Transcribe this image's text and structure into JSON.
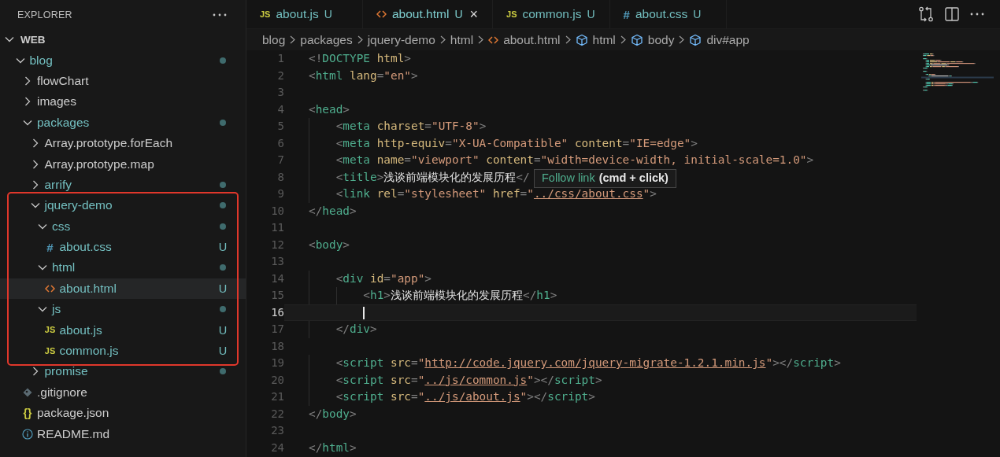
{
  "explorer": {
    "title": "EXPLORER",
    "root": {
      "label": "WEB",
      "expanded": true
    },
    "tree": [
      {
        "label": "blog",
        "kind": "folder",
        "expanded": true,
        "changed": true,
        "selected": false,
        "children": [
          {
            "label": "flowChart",
            "kind": "folder",
            "expanded": false,
            "changed": false,
            "selected": false
          },
          {
            "label": "images",
            "kind": "folder",
            "expanded": false,
            "changed": false,
            "selected": false
          },
          {
            "label": "packages",
            "kind": "folder",
            "expanded": true,
            "changed": true,
            "selected": false,
            "children": [
              {
                "label": "Array.prototype.forEach",
                "kind": "folder",
                "expanded": false,
                "changed": false,
                "selected": false
              },
              {
                "label": "Array.prototype.map",
                "kind": "folder",
                "expanded": false,
                "changed": false,
                "selected": false
              },
              {
                "label": "arrify",
                "kind": "folder",
                "expanded": false,
                "changed": true,
                "selected": false
              },
              {
                "label": "jquery-demo",
                "kind": "folder",
                "expanded": true,
                "changed": true,
                "highlight": true,
                "selected": false,
                "children": [
                  {
                    "label": "css",
                    "kind": "folder",
                    "expanded": true,
                    "changed": true,
                    "selected": false,
                    "children": [
                      {
                        "label": "about.css",
                        "kind": "css",
                        "glyph": "#",
                        "changed": true,
                        "badge": "U",
                        "selected": false
                      }
                    ]
                  },
                  {
                    "label": "html",
                    "kind": "folder",
                    "expanded": true,
                    "changed": true,
                    "selected": false,
                    "children": [
                      {
                        "label": "about.html",
                        "kind": "html",
                        "changed": true,
                        "badge": "U",
                        "selected": true
                      }
                    ]
                  },
                  {
                    "label": "js",
                    "kind": "folder",
                    "expanded": true,
                    "changed": true,
                    "selected": false,
                    "children": [
                      {
                        "label": "about.js",
                        "kind": "js",
                        "glyph": "JS",
                        "changed": true,
                        "badge": "U",
                        "selected": false
                      },
                      {
                        "label": "common.js",
                        "kind": "js",
                        "glyph": "JS",
                        "changed": true,
                        "badge": "U",
                        "selected": false
                      }
                    ]
                  }
                ]
              },
              {
                "label": "promise",
                "kind": "folder",
                "expanded": false,
                "changed": true,
                "selected": false
              }
            ]
          },
          {
            "label": ".gitignore",
            "kind": "git",
            "changed": false,
            "selected": false
          },
          {
            "label": "package.json",
            "kind": "json",
            "glyph": "{}",
            "changed": false,
            "selected": false
          },
          {
            "label": "README.md",
            "kind": "info",
            "changed": false,
            "selected": false
          }
        ]
      }
    ]
  },
  "tabs": [
    {
      "label": "about.js",
      "kind": "js",
      "glyph": "JS",
      "badge": "U",
      "selected": false
    },
    {
      "label": "about.html",
      "kind": "html",
      "badge": "U",
      "close": "×",
      "selected": true
    },
    {
      "label": "common.js",
      "kind": "js",
      "glyph": "JS",
      "badge": "U",
      "selected": false
    },
    {
      "label": "about.css",
      "kind": "css",
      "glyph": "#",
      "badge": "U",
      "selected": false
    }
  ],
  "breadcrumbs": [
    {
      "label": "blog",
      "kind": "folder"
    },
    {
      "label": "packages",
      "kind": "folder"
    },
    {
      "label": "jquery-demo",
      "kind": "folder"
    },
    {
      "label": "html",
      "kind": "folder"
    },
    {
      "label": "about.html",
      "kind": "html"
    },
    {
      "label": "html",
      "kind": "element"
    },
    {
      "label": "body",
      "kind": "element"
    },
    {
      "label": "div#app",
      "kind": "element"
    }
  ],
  "editor": {
    "lines": [
      {
        "number": "1",
        "active": false,
        "tokens": [
          {
            "kind": "punct",
            "text": "<!"
          },
          {
            "kind": "tag",
            "text": "DOCTYPE"
          },
          {
            "kind": "attr",
            "text": " html"
          },
          {
            "kind": "punct",
            "text": ">"
          }
        ]
      },
      {
        "number": "2",
        "active": false,
        "tokens": [
          {
            "kind": "punct",
            "text": "<"
          },
          {
            "kind": "tag",
            "text": "html"
          },
          {
            "kind": "attr",
            "text": " lang"
          },
          {
            "kind": "punct",
            "text": "="
          },
          {
            "kind": "str",
            "text": "\"en\""
          },
          {
            "kind": "punct",
            "text": ">"
          }
        ]
      },
      {
        "number": "3",
        "active": false
      },
      {
        "number": "4",
        "active": false,
        "tokens": [
          {
            "kind": "punct",
            "text": "<"
          },
          {
            "kind": "tag",
            "text": "head"
          },
          {
            "kind": "punct",
            "text": ">"
          }
        ]
      },
      {
        "number": "5",
        "active": false,
        "tokens": [
          {
            "kind": "punct",
            "text": "    <"
          },
          {
            "kind": "tag",
            "text": "meta"
          },
          {
            "kind": "attr",
            "text": " charset"
          },
          {
            "kind": "punct",
            "text": "="
          },
          {
            "kind": "str",
            "text": "\"UTF-8\""
          },
          {
            "kind": "punct",
            "text": ">"
          }
        ]
      },
      {
        "number": "6",
        "active": false,
        "tokens": [
          {
            "kind": "punct",
            "text": "    <"
          },
          {
            "kind": "tag",
            "text": "meta"
          },
          {
            "kind": "attr",
            "text": " http-equiv"
          },
          {
            "kind": "punct",
            "text": "="
          },
          {
            "kind": "str",
            "text": "\"X-UA-Compatible\""
          },
          {
            "kind": "attr",
            "text": " content"
          },
          {
            "kind": "punct",
            "text": "="
          },
          {
            "kind": "str",
            "text": "\"IE=edge\""
          },
          {
            "kind": "punct",
            "text": ">"
          }
        ]
      },
      {
        "number": "7",
        "active": false,
        "tokens": [
          {
            "kind": "punct",
            "text": "    <"
          },
          {
            "kind": "tag",
            "text": "meta"
          },
          {
            "kind": "attr",
            "text": " name"
          },
          {
            "kind": "punct",
            "text": "="
          },
          {
            "kind": "str",
            "text": "\"viewport\""
          },
          {
            "kind": "attr",
            "text": " content"
          },
          {
            "kind": "punct",
            "text": "="
          },
          {
            "kind": "str",
            "text": "\"width=device-width, initial-scale=1.0\""
          },
          {
            "kind": "punct",
            "text": ">"
          }
        ]
      },
      {
        "number": "8",
        "active": false,
        "tokens": [
          {
            "kind": "punct",
            "text": "    <"
          },
          {
            "kind": "tag",
            "text": "title"
          },
          {
            "kind": "punct",
            "text": ">"
          },
          {
            "kind": "text",
            "text": "浅谈前端模块化的发展历程"
          },
          {
            "kind": "punct",
            "text": "</"
          }
        ]
      },
      {
        "number": "9",
        "active": false,
        "tokens": [
          {
            "kind": "punct",
            "text": "    <"
          },
          {
            "kind": "tag",
            "text": "link"
          },
          {
            "kind": "attr",
            "text": " rel"
          },
          {
            "kind": "punct",
            "text": "="
          },
          {
            "kind": "str",
            "text": "\"stylesheet\""
          },
          {
            "kind": "attr",
            "text": " href"
          },
          {
            "kind": "punct",
            "text": "="
          },
          {
            "kind": "str",
            "text": "\""
          },
          {
            "kind": "link",
            "text": "../css/about.css"
          },
          {
            "kind": "str",
            "text": "\""
          },
          {
            "kind": "punct",
            "text": ">"
          }
        ]
      },
      {
        "number": "10",
        "active": false,
        "tokens": [
          {
            "kind": "punct",
            "text": "</"
          },
          {
            "kind": "tag",
            "text": "head"
          },
          {
            "kind": "punct",
            "text": ">"
          }
        ]
      },
      {
        "number": "11",
        "active": false
      },
      {
        "number": "12",
        "active": false,
        "tokens": [
          {
            "kind": "punct",
            "text": "<"
          },
          {
            "kind": "tag",
            "text": "body"
          },
          {
            "kind": "punct",
            "text": ">"
          }
        ]
      },
      {
        "number": "13",
        "active": false
      },
      {
        "number": "14",
        "active": false,
        "tokens": [
          {
            "kind": "punct",
            "text": "    <"
          },
          {
            "kind": "tag",
            "text": "div"
          },
          {
            "kind": "attr",
            "text": " id"
          },
          {
            "kind": "punct",
            "text": "="
          },
          {
            "kind": "str",
            "text": "\"app\""
          },
          {
            "kind": "punct",
            "text": ">"
          }
        ]
      },
      {
        "number": "15",
        "active": false,
        "tokens": [
          {
            "kind": "punct",
            "text": "        <"
          },
          {
            "kind": "tag",
            "text": "h1"
          },
          {
            "kind": "punct",
            "text": ">"
          },
          {
            "kind": "text",
            "text": "浅谈前端模块化的发展历程"
          },
          {
            "kind": "punct",
            "text": "</"
          },
          {
            "kind": "tag",
            "text": "h1"
          },
          {
            "kind": "punct",
            "text": ">"
          }
        ]
      },
      {
        "number": "16",
        "active": true,
        "cursor": true
      },
      {
        "number": "17",
        "active": false,
        "tokens": [
          {
            "kind": "punct",
            "text": "    </"
          },
          {
            "kind": "tag",
            "text": "div"
          },
          {
            "kind": "punct",
            "text": ">"
          }
        ]
      },
      {
        "number": "18",
        "active": false
      },
      {
        "number": "19",
        "active": false,
        "tokens": [
          {
            "kind": "punct",
            "text": "    <"
          },
          {
            "kind": "tag",
            "text": "script"
          },
          {
            "kind": "attr",
            "text": " src"
          },
          {
            "kind": "punct",
            "text": "="
          },
          {
            "kind": "str",
            "text": "\""
          },
          {
            "kind": "link",
            "text": "http://code.jquery.com/jquery-migrate-1.2.1.min.js"
          },
          {
            "kind": "str",
            "text": "\""
          },
          {
            "kind": "punct",
            "text": "></"
          },
          {
            "kind": "tag",
            "text": "script"
          },
          {
            "kind": "punct",
            "text": ">"
          }
        ]
      },
      {
        "number": "20",
        "active": false,
        "tokens": [
          {
            "kind": "punct",
            "text": "    <"
          },
          {
            "kind": "tag",
            "text": "script"
          },
          {
            "kind": "attr",
            "text": " src"
          },
          {
            "kind": "punct",
            "text": "="
          },
          {
            "kind": "str",
            "text": "\""
          },
          {
            "kind": "link",
            "text": "../js/common.js"
          },
          {
            "kind": "str",
            "text": "\""
          },
          {
            "kind": "punct",
            "text": "></"
          },
          {
            "kind": "tag",
            "text": "script"
          },
          {
            "kind": "punct",
            "text": ">"
          }
        ]
      },
      {
        "number": "21",
        "active": false,
        "tokens": [
          {
            "kind": "punct",
            "text": "    <"
          },
          {
            "kind": "tag",
            "text": "script"
          },
          {
            "kind": "attr",
            "text": " src"
          },
          {
            "kind": "punct",
            "text": "="
          },
          {
            "kind": "str",
            "text": "\""
          },
          {
            "kind": "link",
            "text": "../js/about.js"
          },
          {
            "kind": "str",
            "text": "\""
          },
          {
            "kind": "punct",
            "text": "></"
          },
          {
            "kind": "tag",
            "text": "script"
          },
          {
            "kind": "punct",
            "text": ">"
          }
        ]
      },
      {
        "number": "22",
        "active": false,
        "tokens": [
          {
            "kind": "punct",
            "text": "</"
          },
          {
            "kind": "tag",
            "text": "body"
          },
          {
            "kind": "punct",
            "text": ">"
          }
        ]
      },
      {
        "number": "23",
        "active": false
      },
      {
        "number": "24",
        "active": false,
        "tokens": [
          {
            "kind": "punct",
            "text": "</"
          },
          {
            "kind": "tag",
            "text": "html"
          },
          {
            "kind": "punct",
            "text": ">"
          }
        ]
      }
    ],
    "tooltip": {
      "action": "Follow link",
      "hint": "(cmd + click)"
    }
  }
}
